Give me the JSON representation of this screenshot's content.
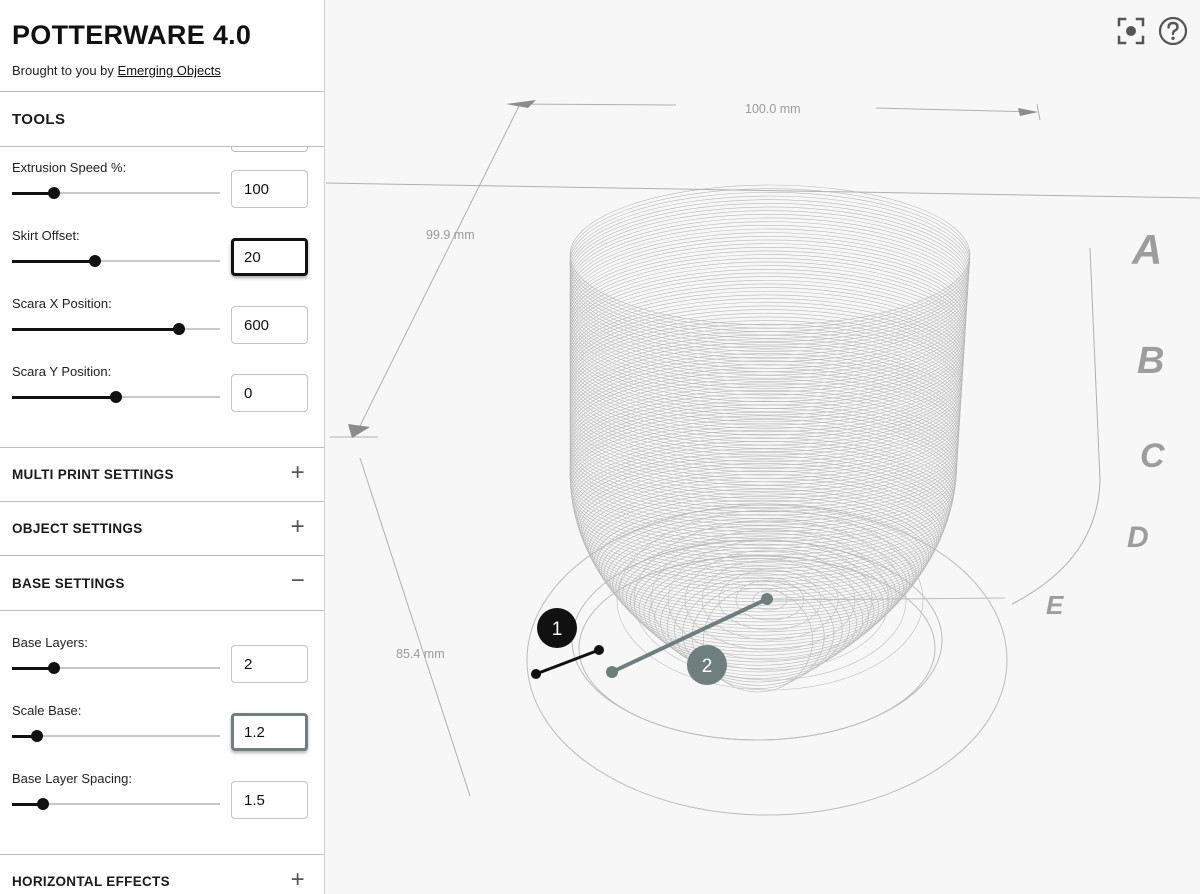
{
  "app": {
    "title": "POTTERWARE 4.0",
    "byline_prefix": "Brought to you by",
    "byline_link": "Emerging Objects"
  },
  "sections": {
    "tools": "TOOLS",
    "multi_print": "MULTI PRINT SETTINGS",
    "object": "OBJECT SETTINGS",
    "base": "BASE SETTINGS",
    "horizontal": "HORIZONTAL EFFECTS",
    "toggle_expand": "+",
    "toggle_collapse": "−"
  },
  "tools_params": [
    {
      "label": "Extrusion Speed %:",
      "value": "100",
      "fraction": 0.2
    },
    {
      "label": "Skirt Offset:",
      "value": "20",
      "fraction": 0.4
    },
    {
      "label": "Scara X Position:",
      "value": "600",
      "fraction": 0.8
    },
    {
      "label": "Scara Y Position:",
      "value": "0",
      "fraction": 0.5
    }
  ],
  "base_params": [
    {
      "label": "Base Layers:",
      "value": "2",
      "fraction": 0.2
    },
    {
      "label": "Scale Base:",
      "value": "1.2",
      "fraction": 0.12
    },
    {
      "label": "Base Layer Spacing:",
      "value": "1.5",
      "fraction": 0.15
    }
  ],
  "viewport": {
    "dim_width": "100.0 mm",
    "dim_depth": "99.9 mm",
    "dim_height": "85.4 mm",
    "letters": [
      "A",
      "B",
      "C",
      "D",
      "E"
    ],
    "markers": [
      "1",
      "2"
    ]
  },
  "icons": {
    "focus": "focus-frame-icon",
    "help": "help-circle-icon"
  },
  "colors": {
    "marker_dark": "#111111",
    "marker_grey": "#6f7f7d",
    "wireframe": "#b8b8b8"
  }
}
